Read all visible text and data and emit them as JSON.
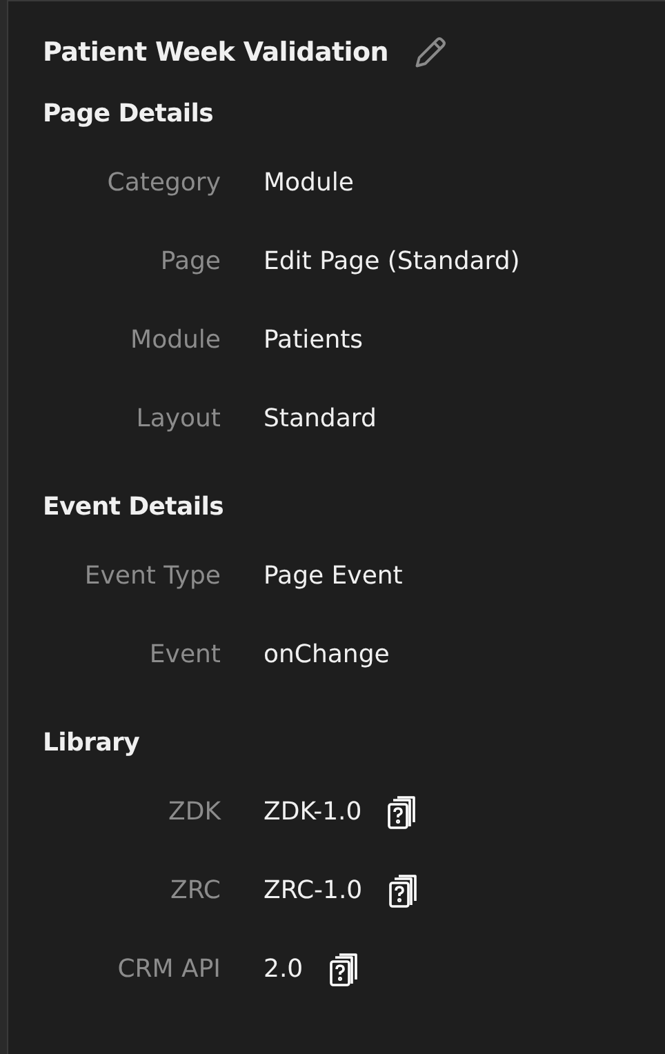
{
  "title": "Patient Week Validation",
  "sections": [
    {
      "heading": "Page Details",
      "kind": "details",
      "rows": [
        {
          "label": "Category",
          "value": "Module"
        },
        {
          "label": "Page",
          "value": "Edit Page (Standard)"
        },
        {
          "label": "Module",
          "value": "Patients"
        },
        {
          "label": "Layout",
          "value": "Standard"
        }
      ]
    },
    {
      "heading": "Event Details",
      "kind": "details",
      "rows": [
        {
          "label": "Event Type",
          "value": "Page Event"
        },
        {
          "label": "Event",
          "value": "onChange"
        }
      ]
    },
    {
      "heading": "Library",
      "kind": "library",
      "rows": [
        {
          "label": "ZDK",
          "value": "ZDK-1.0"
        },
        {
          "label": "ZRC",
          "value": "ZRC-1.0"
        },
        {
          "label": "CRM API",
          "value": "2.0"
        }
      ]
    }
  ]
}
